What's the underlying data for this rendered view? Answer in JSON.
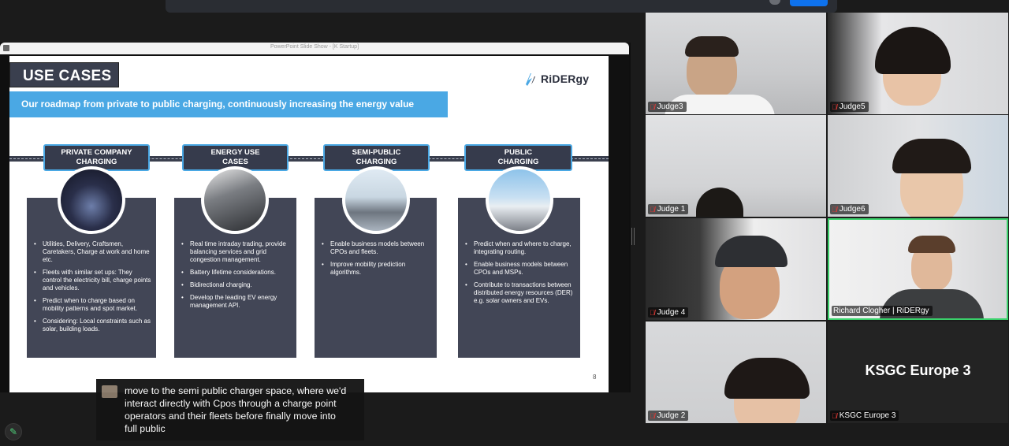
{
  "window": {
    "title": "PowerPoint Slide Show  -  [K Startup]"
  },
  "slide": {
    "title": "USE CASES",
    "logo": "RiDERgy",
    "banner": "Our roadmap from private to public charging, continuously increasing the energy value",
    "page_number": "8",
    "stages": [
      {
        "label_line1": "PRIVATE COMPANY",
        "label_line2": "CHARGING",
        "bullets": [
          "Utilities, Delivery, Craftsmen, Caretakers, Charge at work and home etc.",
          "Fleets with similar set ups: They control the electricity bill, charge points and vehicles.",
          "Predict when to charge based on mobility patterns and spot market.",
          "Considering: Local constraints such as solar, building loads."
        ]
      },
      {
        "label_line1": "ENERGY USE",
        "label_line2": "CASES",
        "bullets": [
          "Real time intraday trading, provide balancing services and grid congestion management.",
          "Battery lifetime considerations.",
          "Bidirectional charging.",
          "Develop the leading EV energy management API."
        ]
      },
      {
        "label_line1": "SEMI-PUBLIC",
        "label_line2": "CHARGING",
        "bullets": [
          "Enable business models between CPOs and fleets.",
          "Improve mobility prediction algorithms."
        ]
      },
      {
        "label_line1": "PUBLIC",
        "label_line2": "CHARGING",
        "bullets": [
          "Predict when and where to charge, integrating routing.",
          "Enable business models between CPOs and MSPs.",
          "Contribute to transactions between distributed energy resources (DER) e.g. solar owners and EVs."
        ]
      }
    ]
  },
  "caption": {
    "lines": [
      "move to the semi public charger space, where we'd",
      "interact directly with Cpos through a charge point",
      "operators and their fleets before finally move into",
      "full public"
    ]
  },
  "participants": [
    {
      "name": "Judge3",
      "muted": true
    },
    {
      "name": "Judge5",
      "muted": true
    },
    {
      "name": "Judge 1",
      "muted": true
    },
    {
      "name": "Judge6",
      "muted": true
    },
    {
      "name": "Judge 4",
      "muted": true
    },
    {
      "name": "Richard Clogher | RiDERgy",
      "muted": false,
      "active_speaker": true
    },
    {
      "name": "Judge 2",
      "muted": true
    },
    {
      "name": "KSGC Europe 3",
      "muted": true,
      "video_off": true,
      "display_name": "KSGC Europe 3"
    }
  ],
  "colors": {
    "banner_blue": "#4aa8e4",
    "dark_navy": "#3a3f4e",
    "active_speaker_green": "#3ad16b",
    "muted_red": "#e53935"
  },
  "icons": {
    "mic_muted": "mic-muted-icon",
    "edit": "pencil-icon"
  }
}
